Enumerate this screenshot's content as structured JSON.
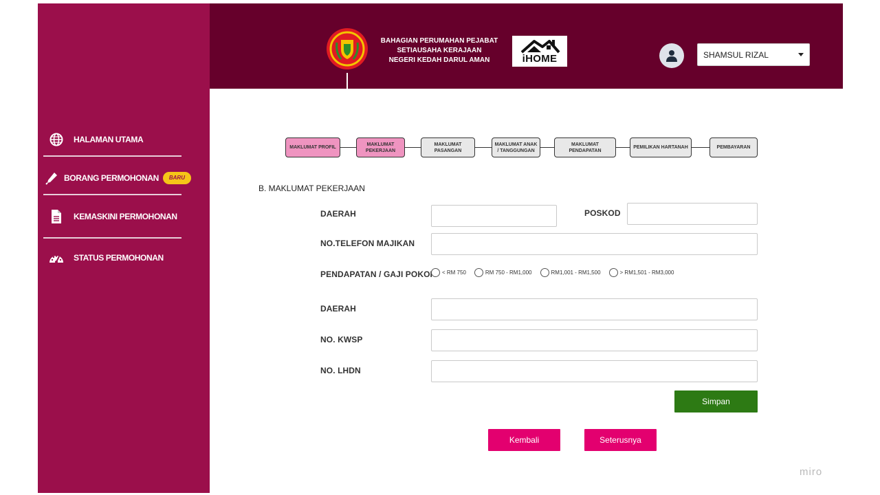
{
  "header": {
    "org_name_lines": [
      "BAHAGIAN PERUMAHAN PEJABAT",
      "SETIAUSAHA KERAJAAN",
      "NEGERI KEDAH DARUL AMAN"
    ],
    "ihome_label": "iHOME",
    "user_name": "SHAMSUL RIZAL"
  },
  "sidebar": {
    "items": [
      {
        "label": "HALAMAN UTAMA",
        "icon": "globe-icon"
      },
      {
        "label": "BORANG PERMOHONAN",
        "icon": "pen-icon",
        "badge": "BARU"
      },
      {
        "label": "KEMASKINI PERMOHONAN",
        "icon": "document-icon"
      },
      {
        "label": "STATUS PERMOHONAN",
        "icon": "speedometer-icon"
      }
    ]
  },
  "steps": [
    {
      "label": "MAKLUMAT PROFIL"
    },
    {
      "label": "MAKLUMAT PEKERJAAN"
    },
    {
      "label": "MAKLUMAT PASANGAN"
    },
    {
      "label": "MAKLUMAT ANAK / TANGGUNGAN"
    },
    {
      "label": "MAKLUMAT PENDAPATAN"
    },
    {
      "label": "PEMILIKAN HARTANAH"
    },
    {
      "label": "PEMBAYARAN"
    }
  ],
  "form": {
    "section_title": "B. MAKLUMAT PEKERJAAN",
    "daerah_label": "DAERAH",
    "poskod_label": "POSKOD",
    "telefon_label": "NO.TELEFON MAJIKAN",
    "pendapatan_label": "PENDAPATAN / GAJI POKOK",
    "income_options": [
      "< RM 750",
      "RM 750 - RM1,000",
      "RM1,001 - RM1,500",
      "> RM1,501 - RM3,000"
    ],
    "daerah2_label": "DAERAH",
    "kwsp_label": "NO. KWSP",
    "lhdn_label": "NO. LHDN"
  },
  "buttons": {
    "simpan": "Simpan",
    "kembali": "Kembali",
    "seterusnya": "Seterusnya"
  },
  "watermark": "miro",
  "colors": {
    "sidebar": "#9b0f4b",
    "header": "#66002b",
    "step_active": "#ef94c0",
    "save_button": "#2d7a14",
    "nav_button": "#e3006f",
    "badge": "#f5c518"
  }
}
